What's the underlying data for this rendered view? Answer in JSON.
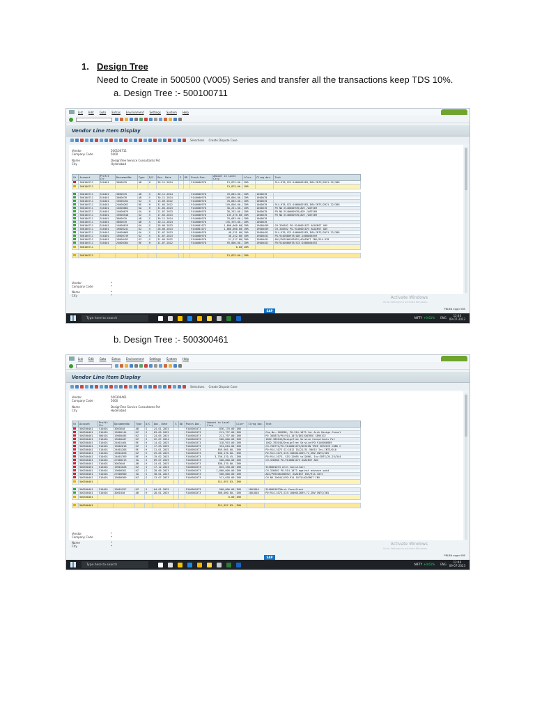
{
  "heading": {
    "number": "1.",
    "title": "Design Tree",
    "description": "Need to Create in 500500 (V005) Series and transfer all the transactions keep TDS 10%."
  },
  "sections": [
    {
      "label": "a.   Design Tree :- 500100711"
    },
    {
      "label": "b.   Design Tree :- 500300461"
    }
  ],
  "sap": {
    "menu": [
      "List",
      "Edit",
      "Goto",
      "Extras",
      "Environment",
      "Settings",
      "System",
      "Help"
    ],
    "window_title": "Vendor Line Item Display",
    "selections_label": "Selections",
    "dispute_label": "Create Dispute Case",
    "header_labels": {
      "vendor": "Vendor",
      "company_code": "Company Code",
      "name": "Name",
      "city": "City"
    },
    "columns": [
      "St",
      "Account",
      "Profit Ctr",
      "DocumentNo",
      "Type",
      "D/C",
      "Doc. Date",
      "S",
      "DD",
      "Punch.Doc.",
      "Amount in Local Crcy",
      "LCurr",
      "Clrng doc.",
      "Text"
    ],
    "activate_title": "Activate Windows",
    "activate_sub": "Go to Settings to activate Windows.",
    "status_right": "PBLBN  epgrd  INS",
    "sap_logo": "SAP"
  },
  "taskbar": {
    "search_placeholder": "Type here to search",
    "ticker_name": "NIFTY",
    "ticker_change": "+0.61%",
    "language": "ENG",
    "time": "12:46",
    "date": "09-07-2023"
  },
  "screens": [
    {
      "vendor": "500100711",
      "company_code": "5000",
      "name": "DesignTree Service Consultants Pvt",
      "city": "Hyderabad",
      "rows": [
        [
          "r",
          "500100711",
          "510401",
          "3000670",
          "AB",
          "H",
          "30.11.2024",
          "",
          "",
          "9140000978",
          "13,875.00-",
          "INR",
          "",
          "914-978,SIS:1000002583,INV:INTS/2021-22/388"
        ],
        [
          "sum",
          "500100711",
          "",
          "",
          "",
          "",
          "",
          "",
          "",
          "",
          "13,875.00-",
          "INR",
          "",
          ""
        ],
        [
          "gap"
        ],
        [
          "g",
          "500100711",
          "510401",
          "3000670",
          "AB",
          "S",
          "30.11.2024",
          "",
          "",
          "9140000978",
          "78,683.00-",
          "INR",
          "1000670",
          ""
        ],
        [
          "g",
          "500100711",
          "510401",
          "3000670",
          "AB",
          "S",
          "30.11.2024",
          "",
          "",
          "9140000978",
          "149,850.00-",
          "INR",
          "1000670",
          ""
        ],
        [
          "g",
          "500100711",
          "510401",
          "19000452",
          "KZ",
          "S",
          "13.09.2022",
          "",
          "",
          "9140000978",
          "78,683.00-",
          "INR",
          "1000670",
          ""
        ],
        [
          "g",
          "500100711",
          "510401",
          "24000262",
          "RE",
          "H",
          "31.05.2022",
          "",
          "",
          "9140000978",
          "149,850.00-",
          "INR",
          "1000670",
          "914-978,SIS:1000002583,INV:INTS/2021-22/388"
        ],
        [
          "g",
          "500100711",
          "510401",
          "14000064",
          "KA",
          "H",
          "31.05.2023",
          "",
          "",
          "9140000978",
          "38,251.00-",
          "INR",
          "1000670",
          "PO NO.9140000978/ADV /A0TS09"
        ],
        [
          "g",
          "500100711",
          "510401",
          "14000079",
          "KA",
          "H",
          "21.07.2023",
          "",
          "",
          "9140000978",
          "38,252.00-",
          "INR",
          "1000670",
          "PO NO.9140000978/ADV /A0TS09"
        ],
        [
          "g",
          "500100711",
          "510401",
          "19000548",
          "KZ",
          "S",
          "17.03.2023",
          "",
          "",
          "9140000978",
          "135,375.00",
          "INR",
          "1000670",
          "PO NO.9140000978/ADV /A0TS09"
        ],
        [
          "g",
          "500100711",
          "510401",
          "3000670",
          "AB",
          "S",
          "30.11.2024",
          "",
          "",
          "9140000978",
          "78,683.00-",
          "INR",
          "1000670",
          ""
        ],
        [
          "g",
          "500100711",
          "510401",
          "3000670",
          "AB",
          "S",
          "30.11.2024",
          "",
          "",
          "9140000978",
          "135,375.00-",
          "INR",
          "1000670",
          ""
        ],
        [
          "g",
          "500100711",
          "510401",
          "14000019",
          "KA",
          "S",
          "28.06.2023",
          "",
          "",
          "9140001073",
          "1,800,000.00",
          "INR",
          "19000459",
          "CH-326602 PO-9140001073 AGAINST ADV"
        ],
        [
          "g",
          "500100711",
          "510401",
          "19000241",
          "KZ",
          "S",
          "28.06.2023",
          "",
          "",
          "9140001073",
          "1,800,000.00",
          "INR",
          "19000459",
          "CH-326602 PO-9140001073 AGAINST ADV"
        ],
        [
          "g",
          "500100711",
          "510401",
          "14000069",
          "KA",
          "S",
          "31.07.2023",
          "",
          "",
          "9140000978",
          "48,231.00",
          "INR",
          "19000451",
          "914-978,SIS:1000002583,INV:INTS/2021-22/388"
        ],
        [
          "g",
          "500100711",
          "510401",
          "19000739",
          "KZ",
          "S",
          "31.07.2023",
          "",
          "",
          "9140000978",
          "38,252.00",
          "INR",
          "19000451",
          "PO-9140000978/ADV-1000004659"
        ],
        [
          "g",
          "500100711",
          "510401",
          "19000452",
          "KZ",
          "S",
          "31.05.2022",
          "",
          "",
          "9140000978",
          "21,217.00",
          "INR",
          "19000451",
          "ADJ/PO9200103851/AGAINST INV/914-978"
        ],
        [
          "g",
          "500100711",
          "510401",
          "24000364",
          "RE",
          "H",
          "31.07.2022",
          "",
          "",
          "9140000978",
          "59,000.00-",
          "INR",
          "19000451",
          "PO:9140000978/SIS:1000004653"
        ],
        [
          "sum",
          "500100711",
          "",
          "",
          "",
          "",
          "",
          "",
          "",
          "",
          "0.00",
          "INR",
          "",
          ""
        ],
        [
          "gap"
        ],
        [
          "sum2",
          "500100711",
          "",
          "",
          "",
          "",
          "",
          "",
          "",
          "",
          "13,875.00-",
          "INR",
          "",
          ""
        ]
      ]
    },
    {
      "vendor": "500300461",
      "company_code": "5000",
      "name": "DesignTree Service Consultants Pvt",
      "city": "Hyderabad",
      "rows": [
        [
          "r",
          "500300461",
          "510401",
          "3003640",
          "AB",
          "S",
          "24.01.2025",
          "",
          "",
          "9140001073",
          "836,170.00",
          "INR",
          "",
          ""
        ],
        [
          "r",
          "500300461",
          "510401",
          "19000144",
          "KZ",
          "S",
          "03.05.2025",
          "",
          "",
          "9140001073",
          "211,797.00",
          "INR",
          "",
          "Chq No.:103838, PO-914-1073 for Arch Design Consul"
        ],
        [
          "r",
          "500300461",
          "500101",
          "19000405",
          "KZ",
          "S",
          "24.05.2025",
          "",
          "",
          "9140001073",
          "211,797.00",
          "INR",
          "",
          "PO 305875/PO:914-1073/DESIGNTREE SERVICE"
        ],
        [
          "r",
          "500300461",
          "510401",
          "19000407",
          "KZ",
          "S",
          "22.07.2024",
          "",
          "",
          "9140001073",
          "500,000.00",
          "INR",
          "",
          "1002.382045/DesignTree Service Consultants Pvt"
        ],
        [
          "r",
          "500300461",
          "510401",
          "24001464",
          "RE",
          "H",
          "14.02.2025",
          "",
          "",
          "9140001073",
          "318,953.00",
          "INR",
          "",
          "1002.392048/DesignTree Service/PO:9140000889"
        ],
        [
          "r",
          "500300461",
          "510401",
          "19002018",
          "KZ",
          "S",
          "17.03.2025",
          "",
          "",
          "9140001073",
          "334,810.00",
          "INR",
          "",
          "CH-768775/PO.9140001073/DESIGN TREE SERVICE CONS C"
        ],
        [
          "r",
          "500300461",
          "510401",
          "24001268",
          "RE",
          "H",
          "31.01.2025",
          "",
          "",
          "9140001073",
          "859,965.00-",
          "INR",
          "",
          "PO:914-1073 SI:1812 IA121/51.50015 Inv.INTS/010"
        ],
        [
          "r",
          "500300461",
          "510401",
          "19001028",
          "KZ",
          "H",
          "29.05.2025",
          "",
          "",
          "9140001073",
          "836,170.00-",
          "INR",
          "",
          "PO:914-1073,SIS:1000012669-72,INV:INTS/365"
        ],
        [
          "r",
          "500300461",
          "510401",
          "24001769",
          "RE",
          "H",
          "19.02.2025",
          "",
          "",
          "9140001073",
          "3,750,170.45-",
          "INR",
          "",
          "PO:914-1073, SIS:12665 to12666, Inv:INTS/24-25/344"
        ],
        [
          "r",
          "500300461",
          "510401",
          "27000213",
          "SA",
          "S",
          "09.07.2025",
          "",
          "",
          "9140001073",
          "500,000.00",
          "INR",
          "",
          "CH-326688 PO-9140001073 AGAINST ADV"
        ],
        [
          "r",
          "500300461",
          "510401",
          "3003640",
          "AB",
          "H",
          "24.01.2025",
          "",
          "",
          "9140001073",
          "836,170.00-",
          "INR",
          "",
          ""
        ],
        [
          "r",
          "500300461",
          "510401",
          "19001028",
          "KZ",
          "S",
          "17.12.2024",
          "",
          "",
          "9140001073",
          "833,338.00",
          "INR",
          "",
          "9140001073 Arch Consultant"
        ],
        [
          "r",
          "500300461",
          "510401",
          "19000361",
          "KZ",
          "S",
          "28.06.2023",
          "",
          "",
          "9140001073",
          "1,800,000.00",
          "INR",
          "",
          "CH-326602 PO-914-1073 against advance paid"
        ],
        [
          "r",
          "500300461",
          "510401",
          "27000980",
          "SA",
          "S",
          "30.01.2023",
          "",
          "",
          "9140001073",
          "500,000.00",
          "INR",
          "",
          "ADJ/PO9200100892/ AGAINST INV/914-1073"
        ],
        [
          "r",
          "500300461",
          "510401",
          "19000360",
          "KZ",
          "S",
          "13.07.2023",
          "",
          "",
          "9140001073",
          "511,038.00",
          "INR",
          "",
          "CH NO 200441/PO:914-1073/AGAINST INV"
        ],
        [
          "sum",
          "500300461",
          "",
          "",
          "",
          "",
          "",
          "",
          "",
          "",
          "511,957.83-",
          "INR",
          "",
          ""
        ],
        [
          "gap"
        ],
        [
          "g",
          "500300461",
          "510401",
          "19001557",
          "KZ",
          "S",
          "04.01.2025",
          "",
          "",
          "9140001073",
          "500,000.00",
          "INR",
          "1001840",
          "9140001073Arch Consultant"
        ],
        [
          "g",
          "500300461",
          "510401",
          "3001840",
          "AB",
          "H",
          "28.01.2025",
          "",
          "",
          "9140001073",
          "500,000.00-",
          "INR",
          "1001840",
          "PO:914-1073,SIS:1000012669-72,INV:INTS/365"
        ],
        [
          "sum",
          "500300461",
          "",
          "",
          "",
          "",
          "",
          "",
          "",
          "",
          "0.00",
          "INR",
          "",
          ""
        ],
        [
          "gap"
        ],
        [
          "sum2",
          "500300461",
          "",
          "",
          "",
          "",
          "",
          "",
          "",
          "",
          "511,957.83-",
          "INR",
          "",
          ""
        ]
      ]
    }
  ],
  "colors": {
    "sap_green": "#3c9a2f",
    "row_sum": "#fdf3b7",
    "row_total": "#fbe89a",
    "header_blue": "#d2dee6"
  }
}
